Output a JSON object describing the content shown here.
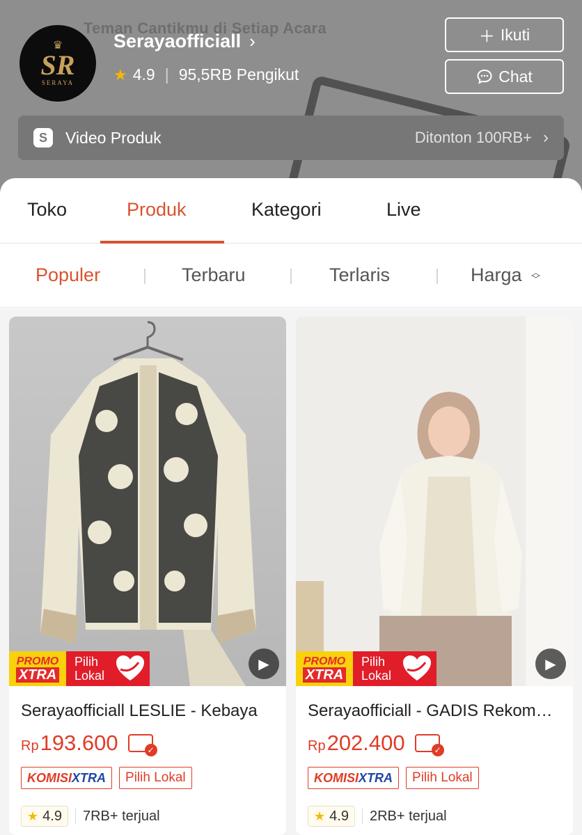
{
  "header": {
    "tagline": "Teman Cantikmu di Setiap Acara",
    "logo_monogram": "SR",
    "logo_word": "SERAYA",
    "shop_name": "Serayaofficiall",
    "rating": "4.9",
    "followers": "95,5RB Pengikut",
    "follow_label": "Ikuti",
    "chat_label": "Chat",
    "video_label": "Video Produk",
    "video_count": "Ditonton 100RB+"
  },
  "tabs": [
    {
      "label": "Toko",
      "active": false
    },
    {
      "label": "Produk",
      "active": true
    },
    {
      "label": "Kategori",
      "active": false
    },
    {
      "label": "Live",
      "active": false
    }
  ],
  "sort": [
    {
      "label": "Populer",
      "active": true
    },
    {
      "label": "Terbaru",
      "active": false
    },
    {
      "label": "Terlaris",
      "active": false
    },
    {
      "label": "Harga",
      "active": false
    }
  ],
  "products": [
    {
      "title": "Serayaofficiall LESLIE - Kebaya",
      "currency": "Rp",
      "price": "193.600",
      "promo_top": "PROMO",
      "promo_bottom": "XTRA",
      "promo_lokal": "Pilih Lokal",
      "badge_komisi_a": "KOMISI",
      "badge_komisi_b": "XTRA",
      "badge_lokal": "Pilih Lokal",
      "rating": "4.9",
      "sold": "7RB+ terjual"
    },
    {
      "title": "Serayaofficiall - GADIS Rekomendasi",
      "currency": "Rp",
      "price": "202.400",
      "promo_top": "PROMO",
      "promo_bottom": "XTRA",
      "promo_lokal": "Pilih Lokal",
      "badge_komisi_a": "KOMISI",
      "badge_komisi_b": "XTRA",
      "badge_lokal": "Pilih Lokal",
      "rating": "4.9",
      "sold": "2RB+ terjual"
    }
  ],
  "colors": {
    "accent": "#d9532f",
    "price": "#e03c26",
    "promo_yellow": "#f9d10c",
    "promo_red": "#e11d2a",
    "header_gray": "#8e8e8e"
  }
}
